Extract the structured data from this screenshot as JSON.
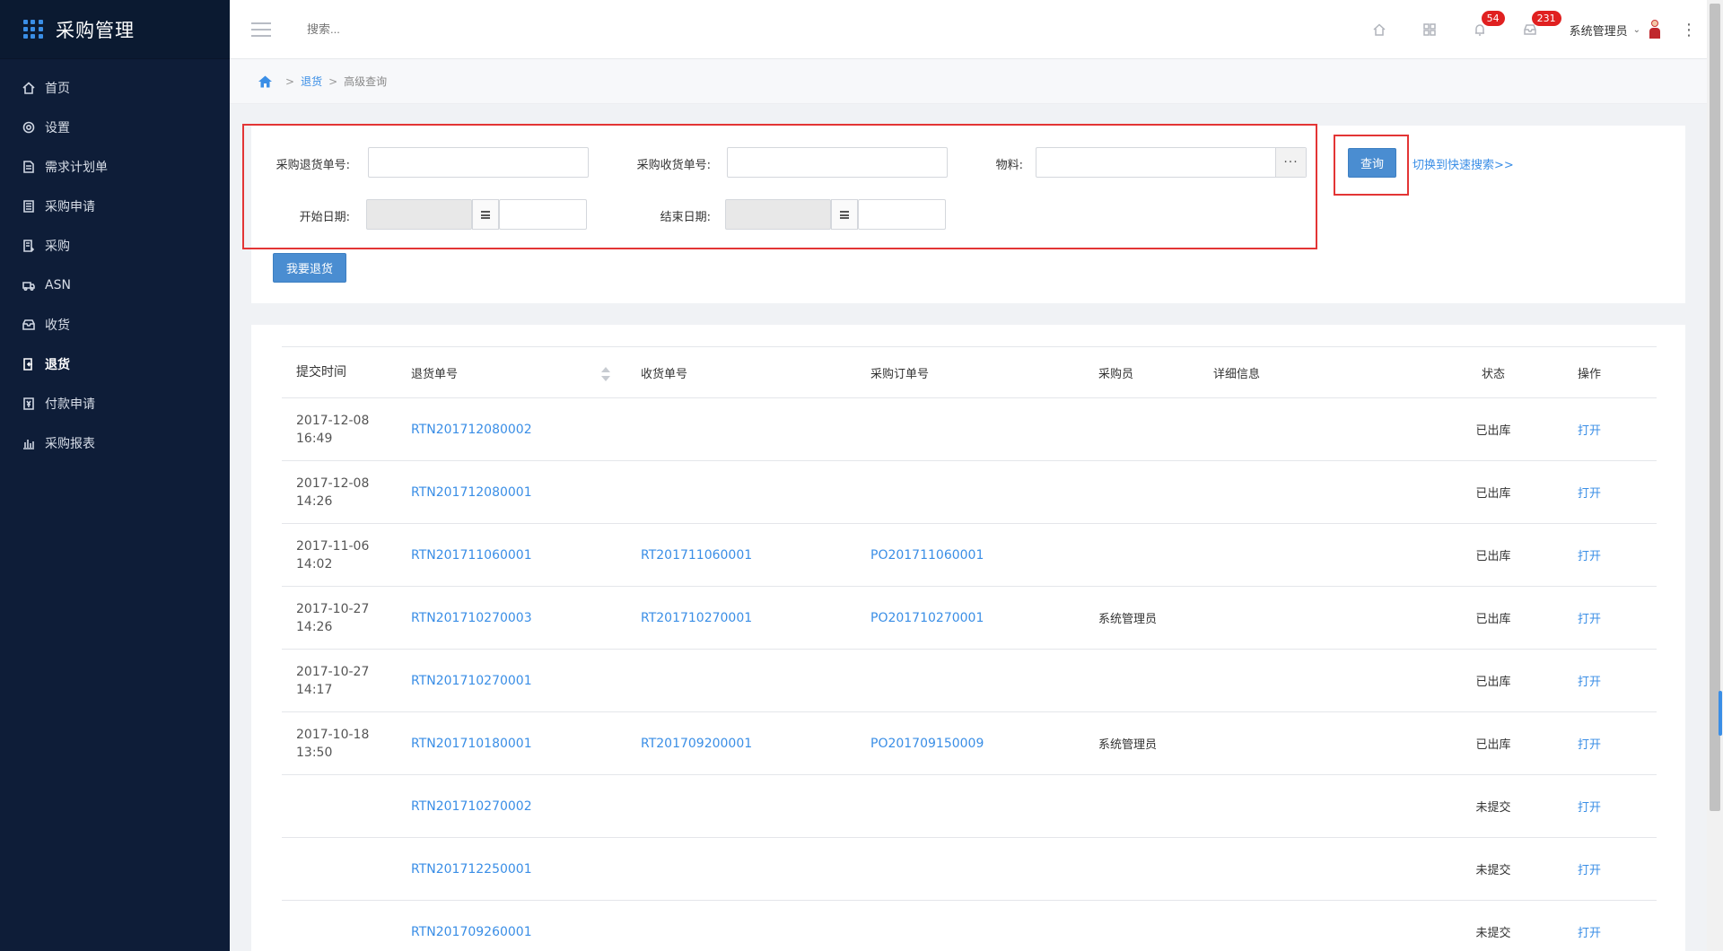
{
  "app": {
    "title": "采购管理"
  },
  "sidebar": {
    "items": [
      {
        "label": "首页",
        "icon": "home-icon",
        "active": false
      },
      {
        "label": "设置",
        "icon": "gear-icon",
        "active": false
      },
      {
        "label": "需求计划单",
        "icon": "document-icon",
        "active": false
      },
      {
        "label": "采购申请",
        "icon": "list-icon",
        "active": false
      },
      {
        "label": "采购",
        "icon": "clipboard-icon",
        "active": false
      },
      {
        "label": "ASN",
        "icon": "truck-icon",
        "active": false
      },
      {
        "label": "收货",
        "icon": "inbox-icon",
        "active": false
      },
      {
        "label": "退货",
        "icon": "return-icon",
        "active": true
      },
      {
        "label": "付款申请",
        "icon": "payment-icon",
        "active": false
      },
      {
        "label": "采购报表",
        "icon": "bar-chart-icon",
        "active": false
      }
    ]
  },
  "header": {
    "search_placeholder": "搜索...",
    "notifications_count": "54",
    "messages_count": "231",
    "user_name": "系统管理员"
  },
  "breadcrumb": {
    "parent": "退货",
    "current": "高级查询",
    "separator": ">"
  },
  "filter": {
    "return_no_label": "采购退货单号:",
    "receipt_no_label": "采购收货单号:",
    "material_label": "物料:",
    "start_date_label": "开始日期:",
    "end_date_label": "结束日期:",
    "material_more": "···",
    "query_button": "查询",
    "switch_link": "切换到快速搜索>>",
    "return_button": "我要退货"
  },
  "table": {
    "headers": {
      "time": "提交时间",
      "return_no": "退货单号",
      "receipt_no": "收货单号",
      "po_no": "采购订单号",
      "buyer": "采购员",
      "detail": "详细信息",
      "status": "状态",
      "action": "操作"
    },
    "rows": [
      {
        "date": "2017-12-08",
        "time": "16:49",
        "return_no": "RTN201712080002",
        "receipt_no": "",
        "po_no": "",
        "buyer": "",
        "status": "已出库",
        "action": "打开"
      },
      {
        "date": "2017-12-08",
        "time": "14:26",
        "return_no": "RTN201712080001",
        "receipt_no": "",
        "po_no": "",
        "buyer": "",
        "status": "已出库",
        "action": "打开"
      },
      {
        "date": "2017-11-06",
        "time": "14:02",
        "return_no": "RTN201711060001",
        "receipt_no": "RT201711060001",
        "po_no": "PO201711060001",
        "buyer": "",
        "status": "已出库",
        "action": "打开"
      },
      {
        "date": "2017-10-27",
        "time": "14:26",
        "return_no": "RTN201710270003",
        "receipt_no": "RT201710270001",
        "po_no": "PO201710270001",
        "buyer": "系统管理员",
        "status": "已出库",
        "action": "打开"
      },
      {
        "date": "2017-10-27",
        "time": "14:17",
        "return_no": "RTN201710270001",
        "receipt_no": "",
        "po_no": "",
        "buyer": "",
        "status": "已出库",
        "action": "打开"
      },
      {
        "date": "2017-10-18",
        "time": "13:50",
        "return_no": "RTN201710180001",
        "receipt_no": "RT201709200001",
        "po_no": "PO201709150009",
        "buyer": "系统管理员",
        "status": "已出库",
        "action": "打开"
      },
      {
        "date": "",
        "time": "",
        "return_no": "RTN201710270002",
        "receipt_no": "",
        "po_no": "",
        "buyer": "",
        "status": "未提交",
        "action": "打开"
      },
      {
        "date": "",
        "time": "",
        "return_no": "RTN201712250001",
        "receipt_no": "",
        "po_no": "",
        "buyer": "",
        "status": "未提交",
        "action": "打开"
      },
      {
        "date": "",
        "time": "",
        "return_no": "RTN201709260001",
        "receipt_no": "",
        "po_no": "",
        "buyer": "",
        "status": "未提交",
        "action": "打开"
      }
    ]
  },
  "colors": {
    "sidebar_bg": "#0e1d38",
    "accent": "#3a8ee6",
    "primary_button": "#4a8dd1",
    "highlight_box": "#e33535",
    "badge": "#e02020"
  }
}
